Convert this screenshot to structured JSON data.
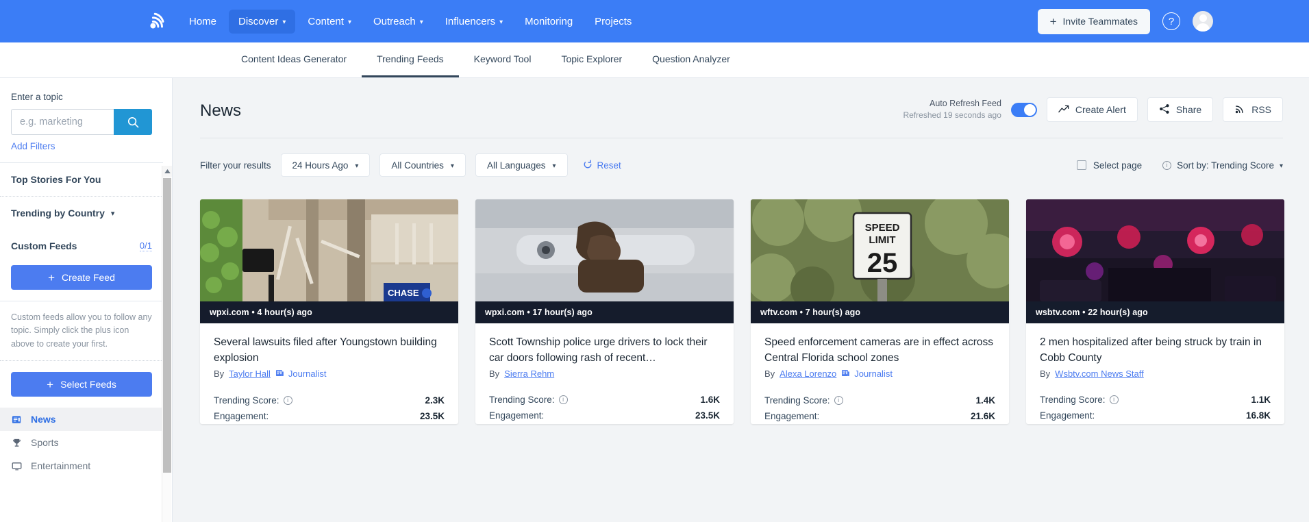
{
  "topnav": {
    "logo": "rss-signal-logo",
    "items": [
      {
        "label": "Home",
        "caret": false,
        "active": false
      },
      {
        "label": "Discover",
        "caret": true,
        "active": true
      },
      {
        "label": "Content",
        "caret": true,
        "active": false
      },
      {
        "label": "Outreach",
        "caret": true,
        "active": false
      },
      {
        "label": "Influencers",
        "caret": true,
        "active": false
      },
      {
        "label": "Monitoring",
        "caret": false,
        "active": false
      },
      {
        "label": "Projects",
        "caret": false,
        "active": false
      }
    ],
    "invite_label": "Invite Teammates",
    "help_glyph": "?",
    "accent": "#3b7df6"
  },
  "subnav": {
    "items": [
      {
        "label": "Content Ideas Generator",
        "active": false
      },
      {
        "label": "Trending Feeds",
        "active": true
      },
      {
        "label": "Keyword Tool",
        "active": false
      },
      {
        "label": "Topic Explorer",
        "active": false
      },
      {
        "label": "Question Analyzer",
        "active": false
      }
    ]
  },
  "sidebar": {
    "topic_label": "Enter a topic",
    "search_placeholder": "e.g. marketing",
    "search_value": "",
    "add_filters": "Add Filters",
    "top_stories": "Top Stories For You",
    "trending_by_country": "Trending by Country",
    "custom_feeds_label": "Custom Feeds",
    "custom_feeds_count": "0/1",
    "create_feed": "Create Feed",
    "help_text": "Custom feeds allow you to follow any topic. Simply click the plus icon above to create your first.",
    "select_feeds": "Select Feeds",
    "feeds": [
      {
        "label": "News",
        "icon": "news-document-icon",
        "active": true
      },
      {
        "label": "Sports",
        "icon": "trophy-icon",
        "active": false
      },
      {
        "label": "Entertainment",
        "icon": "monitor-icon",
        "active": false
      }
    ]
  },
  "main": {
    "page_title": "News",
    "auto_refresh_label": "Auto Refresh Feed",
    "refreshed_text": "Refreshed 19 seconds ago",
    "auto_refresh_on": true,
    "buttons": [
      {
        "label": "Create Alert",
        "icon": "trend-arrow-icon"
      },
      {
        "label": "Share",
        "icon": "share-icon"
      },
      {
        "label": "RSS",
        "icon": "rss-icon"
      }
    ],
    "filter_label": "Filter your results",
    "filters": [
      {
        "label": "24 Hours Ago"
      },
      {
        "label": "All Countries"
      },
      {
        "label": "All Languages"
      }
    ],
    "reset_label": "Reset",
    "select_page_label": "Select page",
    "select_page_checked": false,
    "sort_label": "Sort by: Trending Score"
  },
  "cards": [
    {
      "source": "wpxi.com • 4 hour(s) ago",
      "title": "Several lawsuits filed after Youngstown building explosion",
      "by_prefix": "By",
      "author": "Taylor Hall",
      "journalist_badge": "Journalist",
      "has_badge": true,
      "trending_label": "Trending Score:",
      "trending_value": "2.3K",
      "engagement_label": "Engagement:",
      "engagement_value": "23.5K",
      "image": "collapsed-building-facade-with-debris"
    },
    {
      "source": "wpxi.com • 17 hour(s) ago",
      "title": "Scott Township police urge drivers to lock their car doors following rash of recent…",
      "by_prefix": "By",
      "author": "Sierra Rehm",
      "journalist_badge": "",
      "has_badge": false,
      "trending_label": "Trending Score:",
      "trending_value": "1.6K",
      "engagement_label": "Engagement:",
      "engagement_value": "23.5K",
      "image": "hand-on-car-door-handle"
    },
    {
      "source": "wftv.com • 7 hour(s) ago",
      "title": "Speed enforcement cameras are in effect across Central Florida school zones",
      "by_prefix": "By",
      "author": "Alexa Lorenzo",
      "journalist_badge": "Journalist",
      "has_badge": true,
      "trending_label": "Trending Score:",
      "trending_value": "1.4K",
      "engagement_label": "Engagement:",
      "engagement_value": "21.6K",
      "image": "speed-limit-25-sign"
    },
    {
      "source": "wsbtv.com • 22 hour(s) ago",
      "title": "2 men hospitalized after being struck by train in Cobb County",
      "by_prefix": "By",
      "author": "Wsbtv.com News Staff",
      "journalist_badge": "",
      "has_badge": false,
      "trending_label": "Trending Score:",
      "trending_value": "1.1K",
      "engagement_label": "Engagement:",
      "engagement_value": "16.8K",
      "image": "police-car-lights-at-night"
    }
  ]
}
